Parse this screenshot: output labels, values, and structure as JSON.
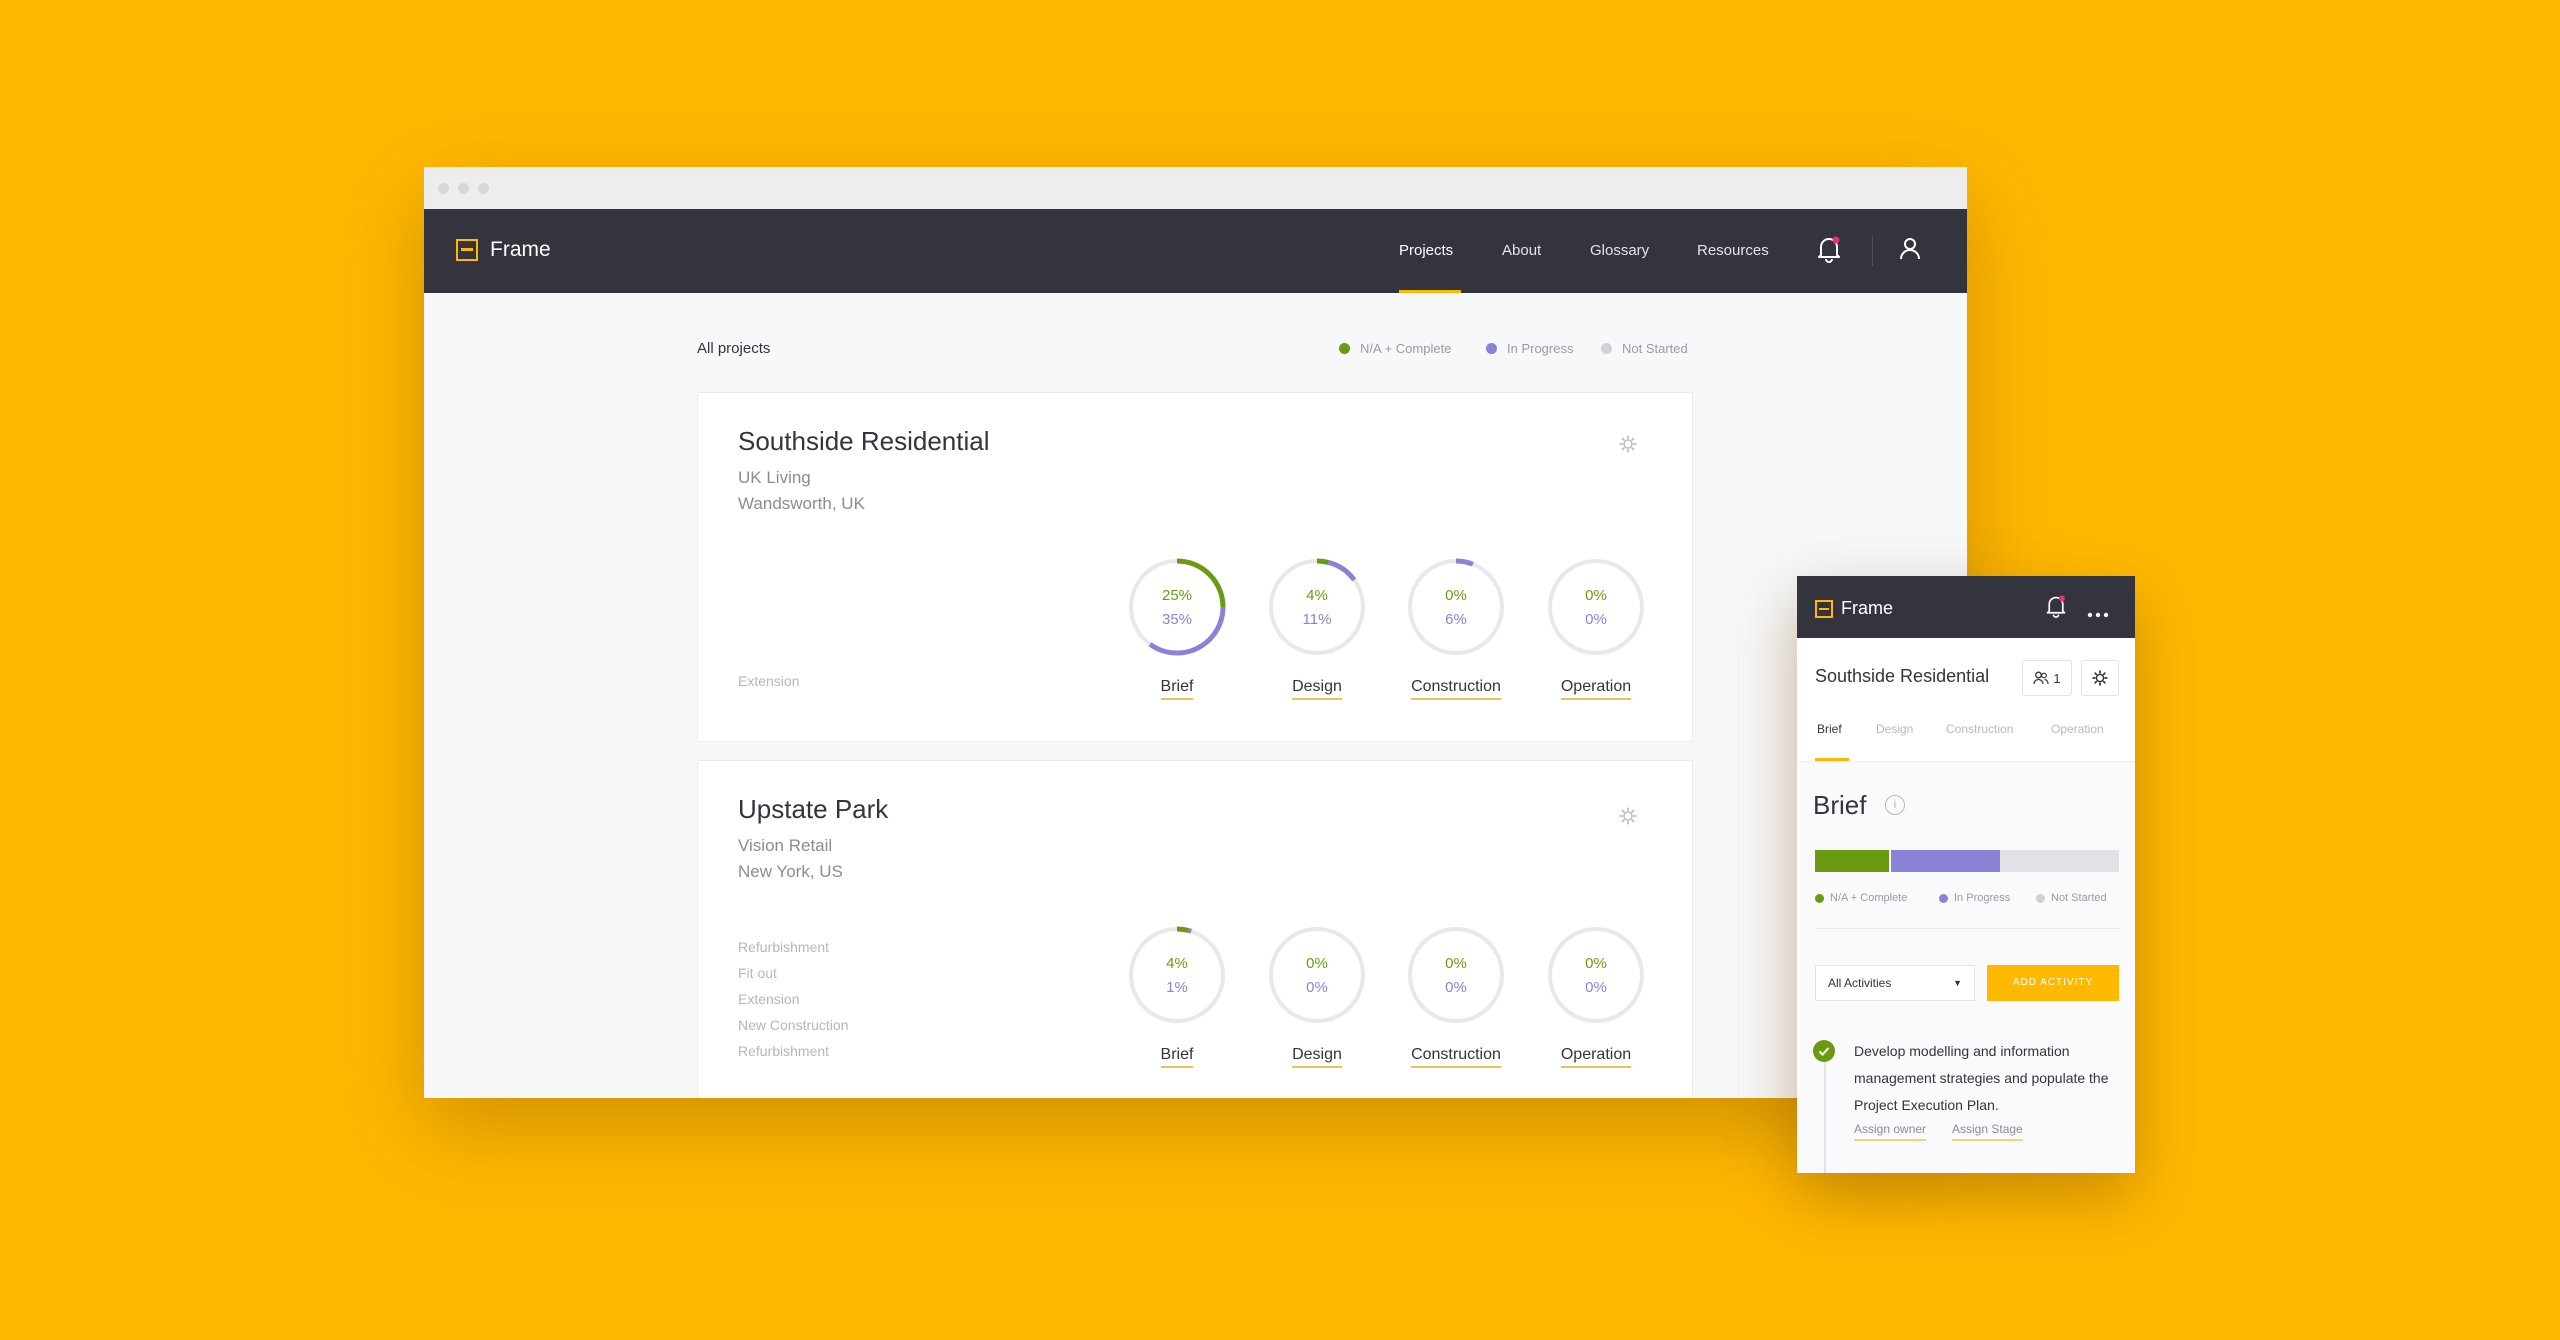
{
  "desktop": {
    "app_name": "Frame",
    "nav": [
      {
        "label": "Projects",
        "active": true
      },
      {
        "label": "About",
        "active": false
      },
      {
        "label": "Glossary",
        "active": false
      },
      {
        "label": "Resources",
        "active": false
      }
    ],
    "page_heading": "All projects",
    "legend": [
      {
        "label": "N/A + Complete",
        "color": "#6a9a10"
      },
      {
        "label": "In Progress",
        "color": "#8a82d6"
      },
      {
        "label": "Not Started",
        "color": "#d0d0d6"
      }
    ],
    "projects": [
      {
        "title": "Southside Residential",
        "client": "UK Living",
        "location": "Wandsworth, UK",
        "tags": [
          "Extension"
        ],
        "stages": [
          {
            "label": "Brief",
            "complete": "25%",
            "in_progress": "35%"
          },
          {
            "label": "Design",
            "complete": "4%",
            "in_progress": "11%"
          },
          {
            "label": "Construction",
            "complete": "0%",
            "in_progress": "6%"
          },
          {
            "label": "Operation",
            "complete": "0%",
            "in_progress": "0%"
          }
        ]
      },
      {
        "title": "Upstate Park",
        "client": "Vision Retail",
        "location": "New York, US",
        "tags": [
          "Refurbishment",
          "Fit out",
          "Extension",
          "New Construction",
          "Refurbishment"
        ],
        "stages": [
          {
            "label": "Brief",
            "complete": "4%",
            "in_progress": "1%"
          },
          {
            "label": "Design",
            "complete": "0%",
            "in_progress": "0%"
          },
          {
            "label": "Construction",
            "complete": "0%",
            "in_progress": "0%"
          },
          {
            "label": "Operation",
            "complete": "0%",
            "in_progress": "0%"
          }
        ]
      }
    ]
  },
  "mobile": {
    "app_name": "Frame",
    "project_title": "Southside Residential",
    "team_count": "1",
    "tabs": [
      {
        "label": "Brief",
        "active": true
      },
      {
        "label": "Design",
        "active": false
      },
      {
        "label": "Construction",
        "active": false
      },
      {
        "label": "Operation",
        "active": false
      }
    ],
    "section_title": "Brief",
    "progress": {
      "complete": 0.25,
      "in_progress": 0.36
    },
    "legend": [
      "N/A + Complete",
      "In Progress",
      "Not Started"
    ],
    "filter_value": "All Activities",
    "add_button": "ADD ACTIVITY",
    "activity": {
      "text": "Develop modelling and information management strategies and populate the Project Execution Plan.",
      "assign_owner": "Assign owner",
      "assign_stage": "Assign Stage"
    }
  },
  "colors": {
    "background": "#FFB900",
    "nav_bg": "#33343d",
    "accent": "#FFB900",
    "complete": "#6a9a10",
    "in_progress": "#8a82d6",
    "not_started": "#e2e2e6"
  }
}
